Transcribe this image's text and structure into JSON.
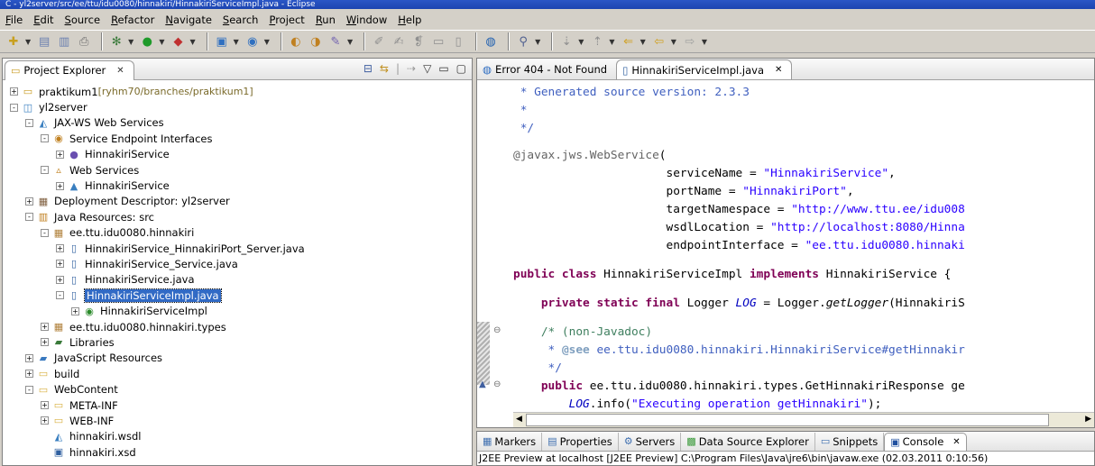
{
  "window": {
    "title": "C - yl2server/src/ee/ttu/idu0080/hinnakiri/HinnakiriServiceImpl.java - Eclipse"
  },
  "menu": [
    "File",
    "Edit",
    "Source",
    "Refactor",
    "Navigate",
    "Search",
    "Project",
    "Run",
    "Window",
    "Help"
  ],
  "explorer": {
    "tab_label": "Project Explorer",
    "tree": [
      {
        "indent": 0,
        "exp": "+",
        "icon": "project-icon",
        "label": "praktikum1",
        "suffix": " [ryhm70/branches/praktikum1]"
      },
      {
        "indent": 0,
        "exp": "-",
        "icon": "web-project-icon",
        "label": "yl2server"
      },
      {
        "indent": 1,
        "exp": "-",
        "icon": "jaxws-icon",
        "label": "JAX-WS Web Services"
      },
      {
        "indent": 2,
        "exp": "-",
        "icon": "interface-folder-icon",
        "label": "Service Endpoint Interfaces"
      },
      {
        "indent": 3,
        "exp": "+",
        "icon": "interface-icon",
        "label": "HinnakiriService"
      },
      {
        "indent": 2,
        "exp": "-",
        "icon": "web-services-icon",
        "label": "Web Services"
      },
      {
        "indent": 3,
        "exp": "+",
        "icon": "service-icon",
        "label": "HinnakiriService"
      },
      {
        "indent": 1,
        "exp": "+",
        "icon": "descriptor-icon",
        "label": "Deployment Descriptor: yl2server"
      },
      {
        "indent": 1,
        "exp": "-",
        "icon": "java-resources-icon",
        "label": "Java Resources: src"
      },
      {
        "indent": 2,
        "exp": "-",
        "icon": "package-icon",
        "label": "ee.ttu.idu0080.hinnakiri"
      },
      {
        "indent": 3,
        "exp": "+",
        "icon": "java-file-icon",
        "label": "HinnakiriService_HinnakiriPort_Server.java"
      },
      {
        "indent": 3,
        "exp": "+",
        "icon": "java-file-icon",
        "label": "HinnakiriService_Service.java"
      },
      {
        "indent": 3,
        "exp": "+",
        "icon": "java-file-icon",
        "label": "HinnakiriService.java"
      },
      {
        "indent": 3,
        "exp": "-",
        "icon": "java-file-icon",
        "label": "HinnakiriServiceImpl.java",
        "selected": true
      },
      {
        "indent": 4,
        "exp": "+",
        "icon": "class-icon",
        "label": "HinnakiriServiceImpl"
      },
      {
        "indent": 2,
        "exp": "+",
        "icon": "package-icon",
        "label": "ee.ttu.idu0080.hinnakiri.types"
      },
      {
        "indent": 2,
        "exp": "+",
        "icon": "libraries-icon",
        "label": "Libraries"
      },
      {
        "indent": 1,
        "exp": "+",
        "icon": "js-resources-icon",
        "label": "JavaScript Resources"
      },
      {
        "indent": 1,
        "exp": "+",
        "icon": "folder-icon",
        "label": "build"
      },
      {
        "indent": 1,
        "exp": "-",
        "icon": "folder-icon",
        "label": "WebContent"
      },
      {
        "indent": 2,
        "exp": "+",
        "icon": "folder-icon",
        "label": "META-INF"
      },
      {
        "indent": 2,
        "exp": "+",
        "icon": "folder-icon",
        "label": "WEB-INF"
      },
      {
        "indent": 2,
        "exp": " ",
        "icon": "wsdl-file-icon",
        "label": "hinnakiri.wsdl"
      },
      {
        "indent": 2,
        "exp": " ",
        "icon": "xsd-file-icon",
        "label": "hinnakiri.xsd"
      }
    ]
  },
  "editor": {
    "tabs": [
      {
        "label": "Error 404 - Not Found",
        "icon": "browser-icon",
        "active": false
      },
      {
        "label": "HinnakiriServiceImpl.java",
        "icon": "java-file-icon",
        "active": true
      }
    ],
    "code": {
      "l1": " * Generated source version: 2.3.3",
      "l2": " *",
      "l3": " */",
      "l4a": "@javax.jws.",
      "l4b": "WebService",
      "l4c": "(",
      "l5a": "                      serviceName = ",
      "l5b": "\"HinnakiriService\"",
      "l5c": ",",
      "l6a": "                      portName = ",
      "l6b": "\"HinnakiriPort\"",
      "l6c": ",",
      "l7a": "                      targetNamespace = ",
      "l7b": "\"http://www.ttu.ee/idu008",
      "l8a": "                      wsdlLocation = ",
      "l8b": "\"http://localhost:8080/Hinna",
      "l9a": "                      endpointInterface = ",
      "l9b": "\"ee.ttu.idu0080.hinnaki",
      "l10a": "public class",
      "l10b": " HinnakiriServiceImpl ",
      "l10c": "implements",
      "l10d": " HinnakiriService {",
      "l11a": "    private static final",
      "l11b": " Logger ",
      "l11c": "LOG",
      "l11d": " = Logger.",
      "l11e": "getLogger",
      "l11f": "(HinnakiriS",
      "l12": "    /* (non-Javadoc)",
      "l13a": "     * ",
      "l13b": "@see",
      "l13c": " ee.ttu.idu0080.hinnakiri.HinnakiriService#getHinnakir",
      "l14": "     */",
      "l15a": "    public",
      "l15b": " ee.ttu.idu0080.hinnakiri.types.GetHinnakiriResponse ge",
      "l16a": "        ",
      "l16b": "LOG",
      "l16c": ".info(",
      "l16d": "\"Executing operation getHinnakiri\"",
      "l16e": ");"
    }
  },
  "console": {
    "tabs": [
      {
        "label": "Markers",
        "icon": "markers-icon"
      },
      {
        "label": "Properties",
        "icon": "properties-icon"
      },
      {
        "label": "Servers",
        "icon": "servers-icon"
      },
      {
        "label": "Data Source Explorer",
        "icon": "datasource-icon"
      },
      {
        "label": "Snippets",
        "icon": "snippets-icon"
      },
      {
        "label": "Console",
        "icon": "console-icon",
        "active": true
      }
    ],
    "line": "J2EE Preview at localhost [J2EE Preview] C:\\Program Files\\Java\\jre6\\bin\\javaw.exe (02.03.2011 0:10:56)"
  }
}
